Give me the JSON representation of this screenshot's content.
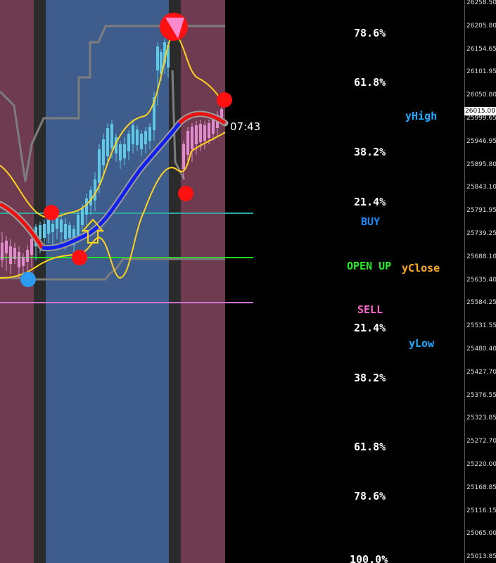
{
  "price_axis": {
    "ticks": [
      "26258.50",
      "26205.80",
      "26154.65",
      "26101.95",
      "26050.80",
      "25999.65",
      "25946.95",
      "25895.80",
      "25843.10",
      "25791.95",
      "25739.25",
      "25688.10",
      "25635.40",
      "25584.25",
      "25531.55",
      "25480.40",
      "25427.70",
      "25376.55",
      "25323.85",
      "25272.70",
      "25220.00",
      "25168.85",
      "25116.15",
      "25065.00",
      "25013.85"
    ],
    "current_price": "26015.00"
  },
  "countdown": "07:43",
  "fib_labels": [
    "78.6%",
    "61.8%",
    "38.2%",
    "21.4%",
    "21.4%",
    "38.2%",
    "61.8%",
    "78.6%",
    "100.0%"
  ],
  "levels": {
    "yhigh": "yHigh",
    "buy": "BUY",
    "open_up": "OPEN UP",
    "yclose": "yClose",
    "sell": "SELL",
    "ylow": "yLow"
  },
  "colors": {
    "session_red": "#6e3b50",
    "session_blue": "#3e5c8c",
    "session_gap": "#2b2b2b",
    "bull_candle": "#5ec8e5",
    "bear_candle": "#e08ccf",
    "band": "#ffd21e",
    "channel": "#7d7d7d",
    "buy_line": "#2ea8a0",
    "open_line": "#22dd22",
    "sell_line": "#d070d0",
    "buy_text": "#1e88ff",
    "open_text": "#22ee22",
    "yclose_text": "#ffaa22",
    "sell_text": "#ff66cc",
    "yhigh_text": "#22aaff",
    "ylow_text": "#22aaff"
  }
}
